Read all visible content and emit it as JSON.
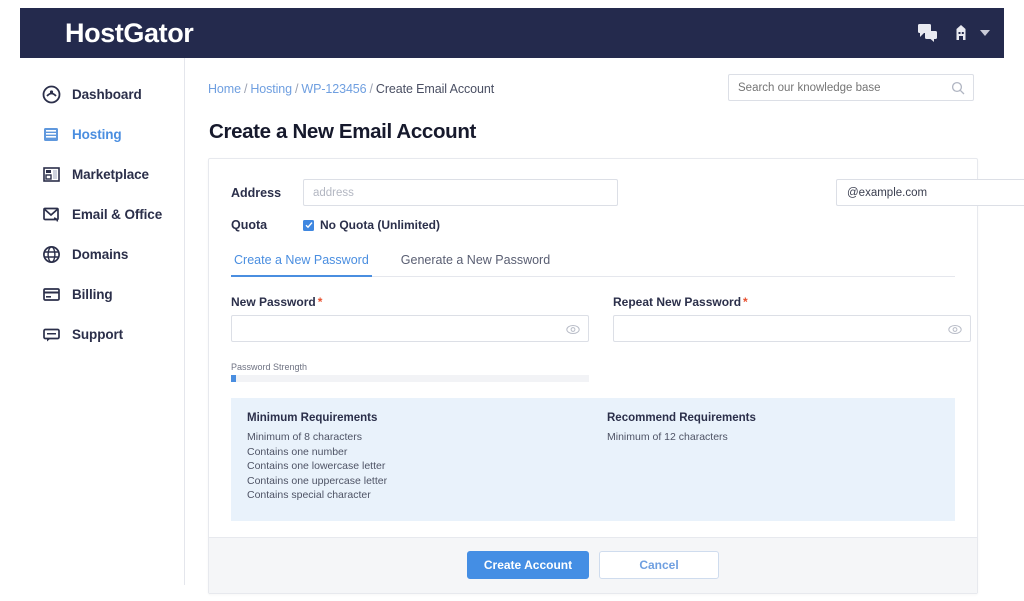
{
  "topbar": {
    "logo": "HostGator",
    "chat_icon": "chat-bubbles-icon",
    "account_icon": "gator-avatar-icon",
    "caret_icon": "chevron-down-icon",
    "bg_color": "#242a4d"
  },
  "sidebar": {
    "items": [
      {
        "label": "Dashboard",
        "icon": "dashboard-icon",
        "active": false
      },
      {
        "label": "Hosting",
        "icon": "server-icon",
        "active": true
      },
      {
        "label": "Marketplace",
        "icon": "marketplace-icon",
        "active": false
      },
      {
        "label": "Email & Office",
        "icon": "email-icon",
        "active": false
      },
      {
        "label": "Domains",
        "icon": "globe-icon",
        "active": false
      },
      {
        "label": "Billing",
        "icon": "billing-card-icon",
        "active": false
      },
      {
        "label": "Support",
        "icon": "support-chat-icon",
        "active": false
      }
    ],
    "active_color": "#4a8ee0"
  },
  "breadcrumb": {
    "items": [
      "Home",
      "Hosting",
      "WP-123456",
      "Create Email Account"
    ],
    "separator": "/",
    "link_color": "#6f9fe0"
  },
  "search": {
    "placeholder": "Search our knowledge base",
    "value": "",
    "icon": "search-icon"
  },
  "page": {
    "title": "Create a New Email Account"
  },
  "form": {
    "address": {
      "label": "Address",
      "placeholder": "address",
      "value": ""
    },
    "domain": {
      "selected": "@example.com",
      "options": [
        "@example.com"
      ],
      "caret_icon": "chevron-down-icon"
    },
    "quota": {
      "label": "Quota",
      "checkbox_label": "No Quota (Unlimited)",
      "checked": true,
      "check_icon": "checkmark-icon"
    }
  },
  "tabs": [
    {
      "label": "Create a New Password",
      "active": true
    },
    {
      "label": "Generate a New Password",
      "active": false
    }
  ],
  "passwords": {
    "new": {
      "label": "New Password",
      "required_marker": "*",
      "value": "",
      "toggle_icon": "eye-icon"
    },
    "repeat": {
      "label": "Repeat New Password",
      "required_marker": "*",
      "value": "",
      "toggle_icon": "eye-icon"
    },
    "strength": {
      "label": "Password Strength",
      "percent": 1.5,
      "fill_color": "#4a8ee0",
      "track_color": "#f2f3f6"
    }
  },
  "requirements": {
    "minimum": {
      "title": "Minimum Requirements",
      "lines": [
        "Minimum of 8 characters",
        "Contains one number",
        "Contains one lowercase letter",
        "Contains one uppercase letter",
        "Contains special character"
      ]
    },
    "recommend": {
      "title": "Recommend Requirements",
      "lines": [
        "Minimum of 12 characters"
      ]
    },
    "bg_color": "#e9f2fb"
  },
  "footer": {
    "submit_label": "Create Account",
    "cancel_label": "Cancel",
    "primary_color": "#448ee4"
  }
}
